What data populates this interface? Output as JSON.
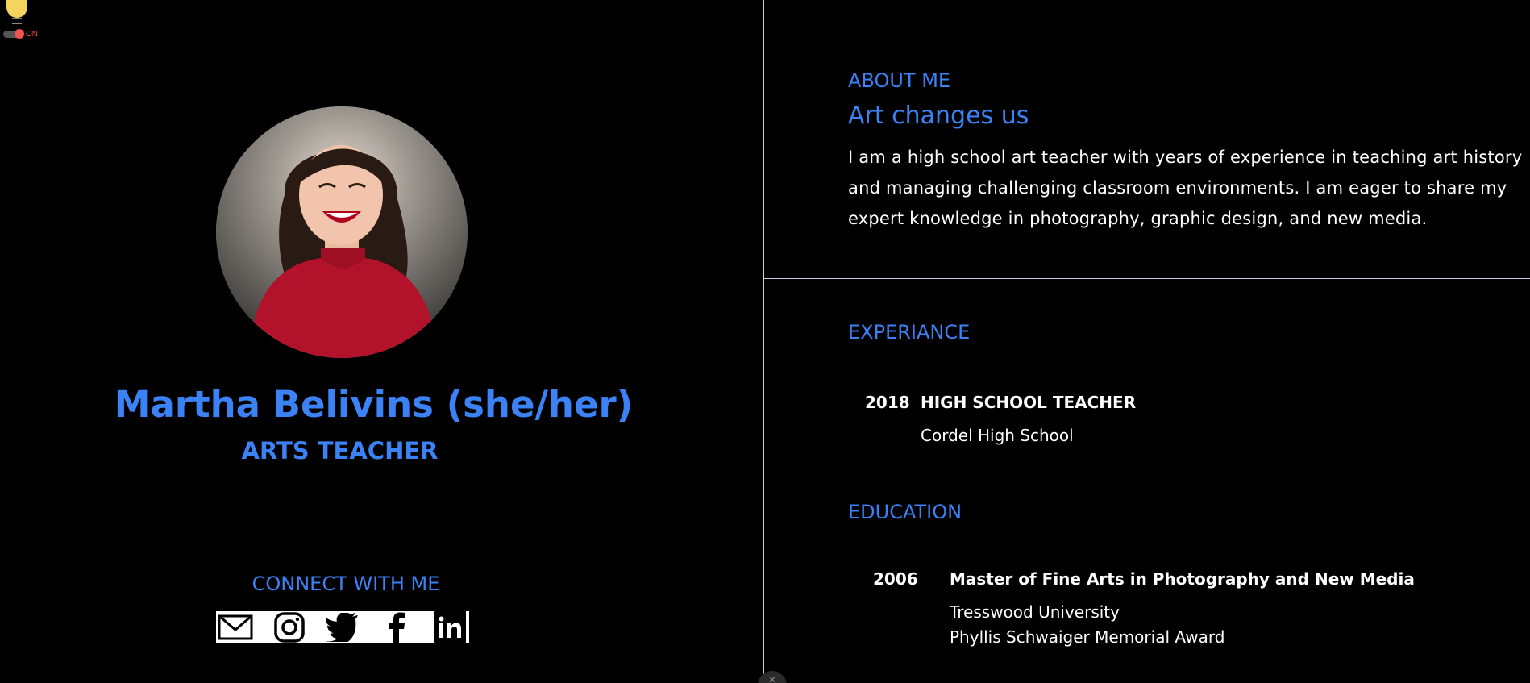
{
  "theme_toggle": {
    "state_label": "ON",
    "icon": "lightbulb-icon",
    "colors": {
      "bulb": "#f4d35e",
      "knob": "#ef5350",
      "label": "#ef5350"
    }
  },
  "profile": {
    "name": "Martha Belivins (she/her)",
    "role": "ARTS TEACHER",
    "avatar_alt": "profile-photo"
  },
  "connect": {
    "title": "CONNECT WITH ME",
    "links": [
      {
        "name": "email",
        "icon": "mail-icon"
      },
      {
        "name": "instagram",
        "icon": "instagram-icon"
      },
      {
        "name": "twitter",
        "icon": "twitter-icon"
      },
      {
        "name": "facebook",
        "icon": "facebook-icon"
      },
      {
        "name": "linkedin",
        "icon": "linkedin-icon"
      }
    ]
  },
  "about": {
    "label": "ABOUT ME",
    "heading": "Art changes us",
    "text": "I am a high school art teacher with years of experience in teaching art history and managing challenging classroom environments. I am eager to share my expert knowledge in photography, graphic design, and new media."
  },
  "experience": {
    "label": "EXPERIANCE",
    "items": [
      {
        "year": "2018",
        "title": "HIGH SCHOOL TEACHER",
        "org": "Cordel High School"
      }
    ]
  },
  "education": {
    "label": "EDUCATION",
    "items": [
      {
        "year": "2006",
        "title": "Master of Fine Arts in Photography and New Media",
        "org": "Tresswood University",
        "award": "Phyllis Schwaiger Memorial Award"
      }
    ]
  },
  "colors": {
    "accent": "#3b82f6",
    "background": "#000000",
    "divider": "#c9d1e0",
    "text": "#ffffff"
  }
}
